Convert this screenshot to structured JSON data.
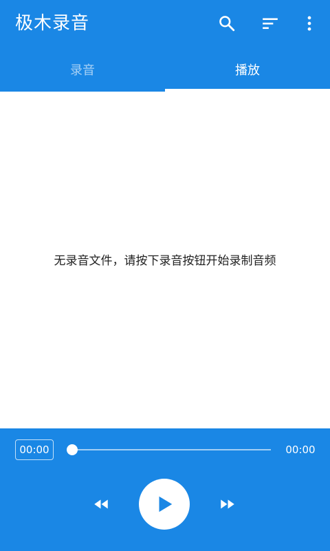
{
  "app": {
    "title": "极木录音"
  },
  "toolbar": {
    "icons": [
      "search-icon",
      "sort-icon",
      "more-vert-icon"
    ]
  },
  "tabs": [
    {
      "label": "录音",
      "selected": false
    },
    {
      "label": "播放",
      "selected": true
    }
  ],
  "content": {
    "empty_message": "无录音文件，请按下录音按钮开始录制音频"
  },
  "player": {
    "current_time": "00:00",
    "total_time": "00:00",
    "progress": 0,
    "controls": [
      "rewind-icon",
      "play-icon",
      "fast-forward-icon"
    ]
  },
  "colors": {
    "primary": "#1a87e5",
    "on_primary": "#ffffff",
    "background": "#ffffff",
    "text": "#222222"
  }
}
